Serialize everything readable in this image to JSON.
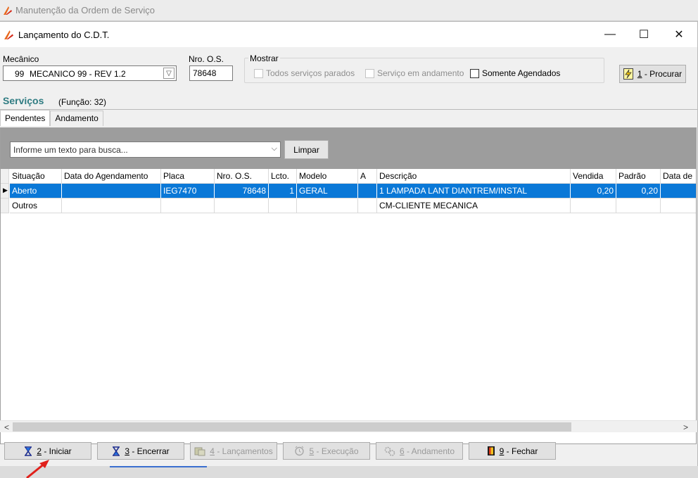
{
  "background_window": {
    "title": "Manutenção da Ordem de Serviço"
  },
  "dialog": {
    "title": "Lançamento do C.D.T.",
    "controls": {
      "minimize": "—",
      "maximize": "☐",
      "close": "✕"
    }
  },
  "filters": {
    "mecanico_label": "Mecânico",
    "mecanico_code": "99",
    "mecanico_name": "MECANICO 99 - REV 1.2",
    "os_label": "Nro. O.S.",
    "os_value": "78648",
    "mostrar_label": "Mostrar",
    "checkboxes": [
      {
        "label": "Todos serviços parados",
        "checked": false,
        "enabled": false
      },
      {
        "label": "Serviço em andamento",
        "checked": false,
        "enabled": false
      },
      {
        "label": "Somente Agendados",
        "checked": false,
        "enabled": true
      }
    ],
    "procurar_button": {
      "key": "1",
      "label": " - Procurar"
    }
  },
  "servicos": {
    "title": "Serviços",
    "subtitle": "(Função: 32)",
    "tabs": [
      "Pendentes",
      "Andamento"
    ],
    "search_placeholder": "Informe um texto para busca...",
    "limpar_label": "Limpar",
    "columns": [
      "Situação",
      "Data do Agendamento",
      "Placa",
      "Nro. O.S.",
      "Lcto.",
      "Modelo",
      "A",
      "Descrição",
      "Vendida",
      "Padrão",
      "Data de"
    ],
    "rows": [
      {
        "situacao": "Aberto",
        "data_agendamento": "",
        "placa": "IEG7470",
        "nro_os": "78648",
        "lcto": "1",
        "modelo": "GERAL",
        "a": "",
        "descricao": "1 LAMPADA LANT DIANTREM/INSTAL",
        "vendida": "0,20",
        "padrao": "0,20",
        "data": ""
      },
      {
        "situacao": "Outros",
        "data_agendamento": "",
        "placa": "",
        "nro_os": "",
        "lcto": "",
        "modelo": "",
        "a": "",
        "descricao": "CM-CLIENTE MECANICA",
        "vendida": "",
        "padrao": "",
        "data": ""
      }
    ]
  },
  "actions": [
    {
      "key": "2",
      "label": " - Iniciar",
      "icon": "hourglass-icon",
      "enabled": true
    },
    {
      "key": "3",
      "label": " - Encerrar",
      "icon": "hourglass-icon",
      "enabled": true
    },
    {
      "key": "4",
      "label": " - Lançamentos",
      "icon": "launch-icon",
      "enabled": false
    },
    {
      "key": "5",
      "label": " - Execução",
      "icon": "alarm-clock-icon",
      "enabled": false
    },
    {
      "key": "6",
      "label": " - Andamento",
      "icon": "gears-icon",
      "enabled": false
    },
    {
      "key": "9",
      "label": " - Fechar",
      "icon": "exit-door-icon",
      "enabled": true
    }
  ],
  "colors": {
    "selection": "#0a78d7",
    "section_title": "#2f7c82",
    "annotation_arrow": "#e0201b"
  }
}
